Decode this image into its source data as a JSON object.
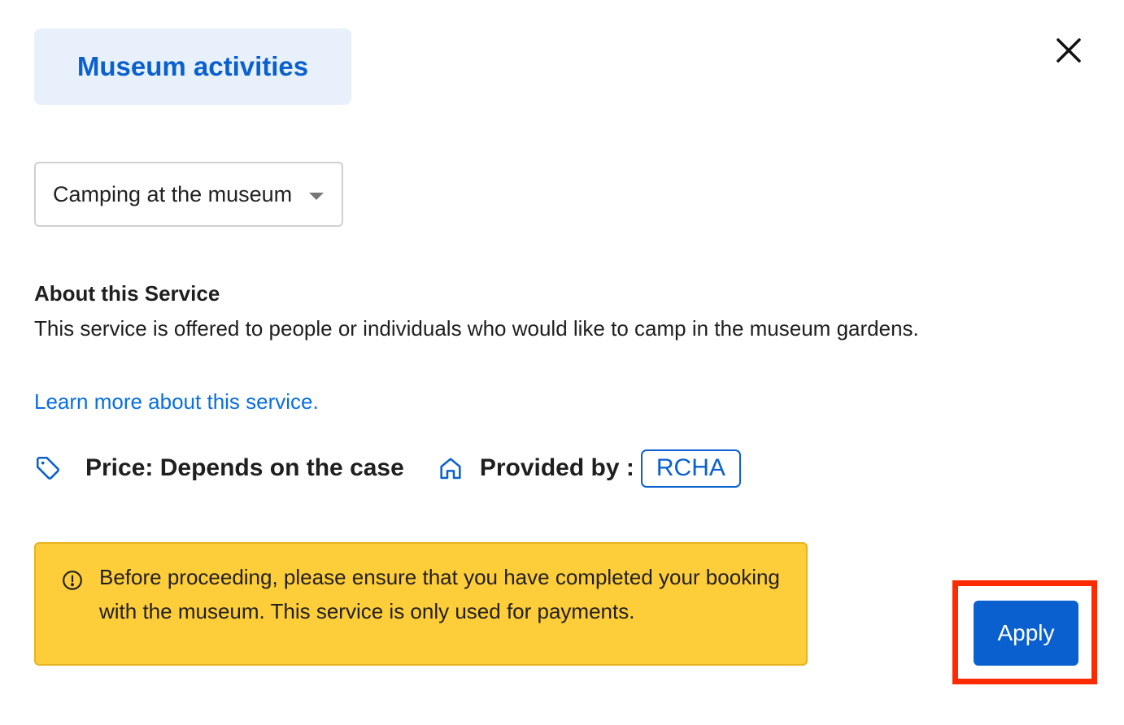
{
  "header": {
    "category_label": "Museum activities",
    "close_icon": "close-icon"
  },
  "service_select": {
    "value": "Camping at the museum",
    "caret_icon": "chevron-down-icon"
  },
  "about": {
    "title": "About this Service",
    "description": "This service is offered to people or individuals who would like to camp in the museum gardens.",
    "learn_more": "Learn more about this service."
  },
  "meta": {
    "price_icon": "tag-icon",
    "price": "Price: Depends on the case",
    "provider_icon": "home-icon",
    "provided_by_label": "Provided by :",
    "provider": "RCHA"
  },
  "notice": {
    "icon": "info-icon",
    "text": "Before proceeding, please ensure that you have completed your booking with the museum. This service is only used for payments."
  },
  "actions": {
    "apply_label": "Apply"
  },
  "colors": {
    "accent": "#0a60cf",
    "link": "#0a6fe0",
    "notice_bg": "#fecd3a",
    "highlight": "#ff2a00"
  }
}
